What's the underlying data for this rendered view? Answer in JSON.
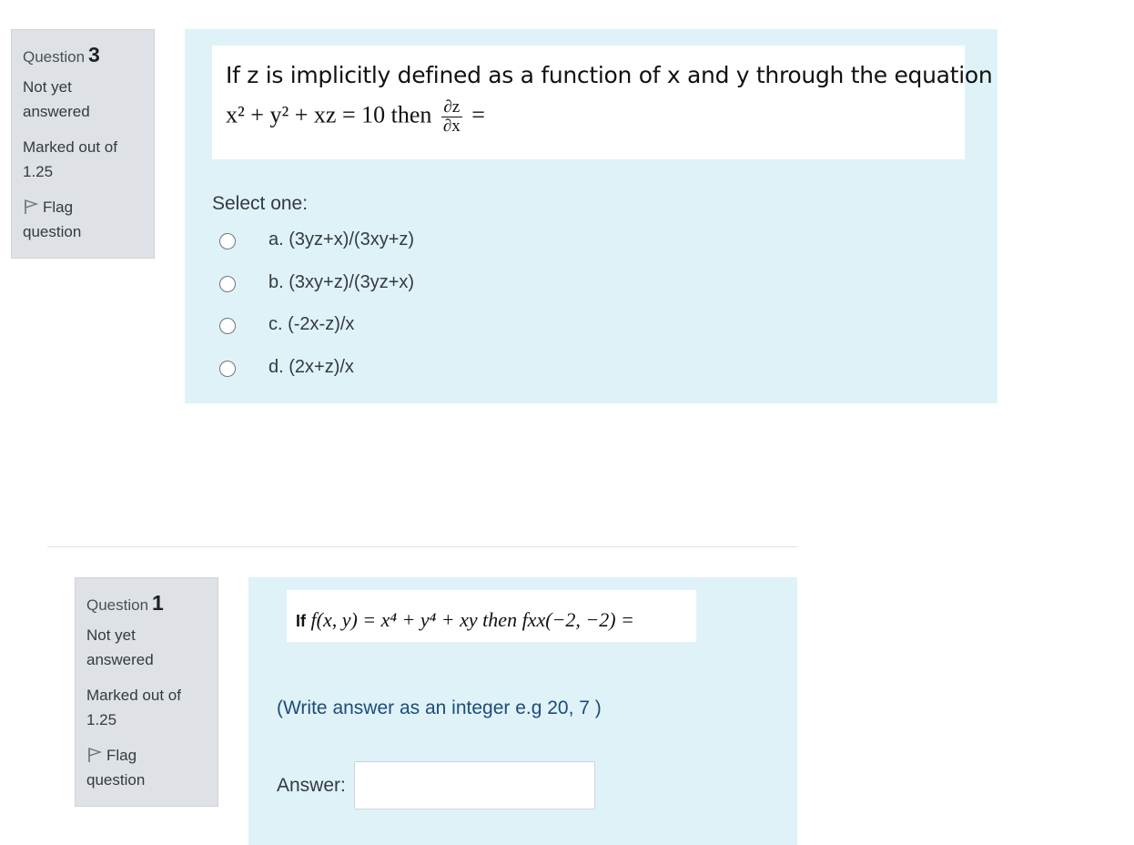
{
  "questions": [
    {
      "info": {
        "question_label": "Question",
        "number": "3",
        "state_line1": "Not yet",
        "state_line2": "answered",
        "grade_line1": "Marked out of",
        "grade_line2": "1.25",
        "flag_line1": "Flag",
        "flag_line2": "question"
      },
      "text_line1": "If z is implicitly defined as a function of x and y through the equation",
      "equation_left": "x² + y² + xz = 10 then",
      "fraction_numerator": "∂z",
      "fraction_denominator": "∂x",
      "equation_right": "=",
      "prompt": "Select one:",
      "options": [
        {
          "label": "a. (3yz+x)/(3xy+z)",
          "selected": false
        },
        {
          "label": "b. (3xy+z)/(3yz+x)",
          "selected": false
        },
        {
          "label": "c. (-2x-z)/x",
          "selected": false
        },
        {
          "label": "d. (2x+z)/x",
          "selected": false
        }
      ]
    },
    {
      "info": {
        "question_label": "Question",
        "number": "1",
        "state_line1": "Not yet",
        "state_line2": "answered",
        "grade_line1": "Marked out of",
        "grade_line2": "1.25",
        "flag_line1": "Flag",
        "flag_line2": "question"
      },
      "formula_if": "If",
      "formula": "f(x, y) = x⁴ + y⁴ + xy then fxx(−2, −2) =",
      "hint": "(Write answer as an integer e.g 20, 7 )",
      "answer_label": "Answer:",
      "answer_value": ""
    }
  ],
  "icons": {
    "flag": "flag-icon"
  },
  "colors": {
    "info_bg": "#dee2e6",
    "content_bg": "#def2f8",
    "hint_text": "#1d4c79"
  }
}
